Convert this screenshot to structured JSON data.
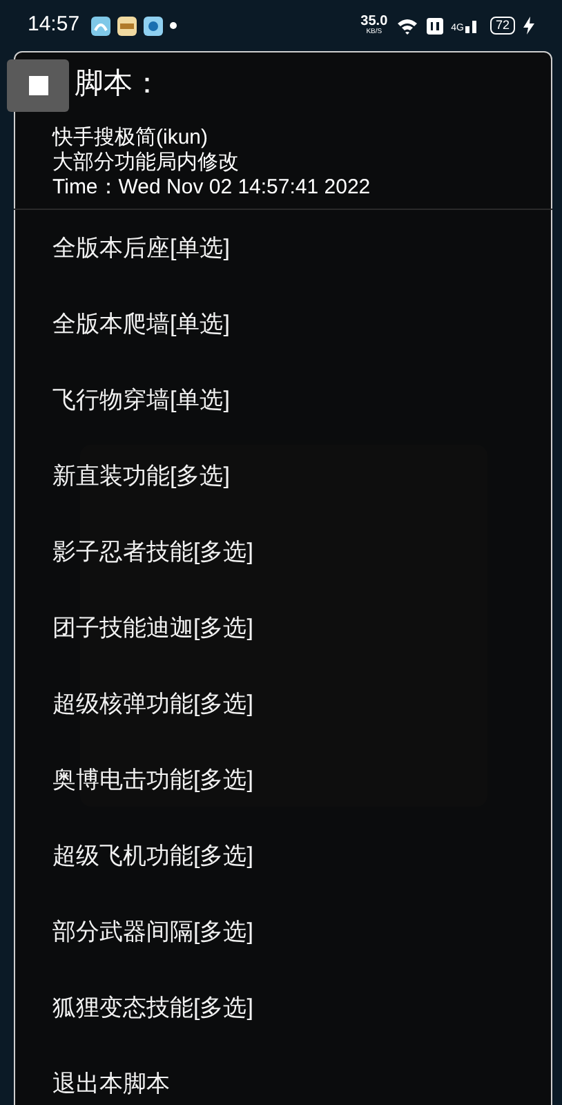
{
  "status_bar": {
    "time": "14:57",
    "net_speed": "35.0",
    "net_unit": "KB/S",
    "network": "4G",
    "battery": "72"
  },
  "dialog": {
    "title": "脚本：",
    "info": [
      "快手搜极简(ikun)",
      "大部分功能局内修改",
      "Time：Wed Nov 02 14:57:41 2022"
    ],
    "items": [
      "全版本后座[单选]",
      "全版本爬墙[单选]",
      "飞行物穿墙[单选]",
      "新直装功能[多选]",
      "影子忍者技能[多选]",
      "团子技能迪迦[多选]",
      "超级核弹功能[多选]",
      "奥博电击功能[多选]",
      "超级飞机功能[多选]",
      "部分武器间隔[多选]",
      "狐狸变态技能[多选]",
      "退出本脚本"
    ]
  }
}
